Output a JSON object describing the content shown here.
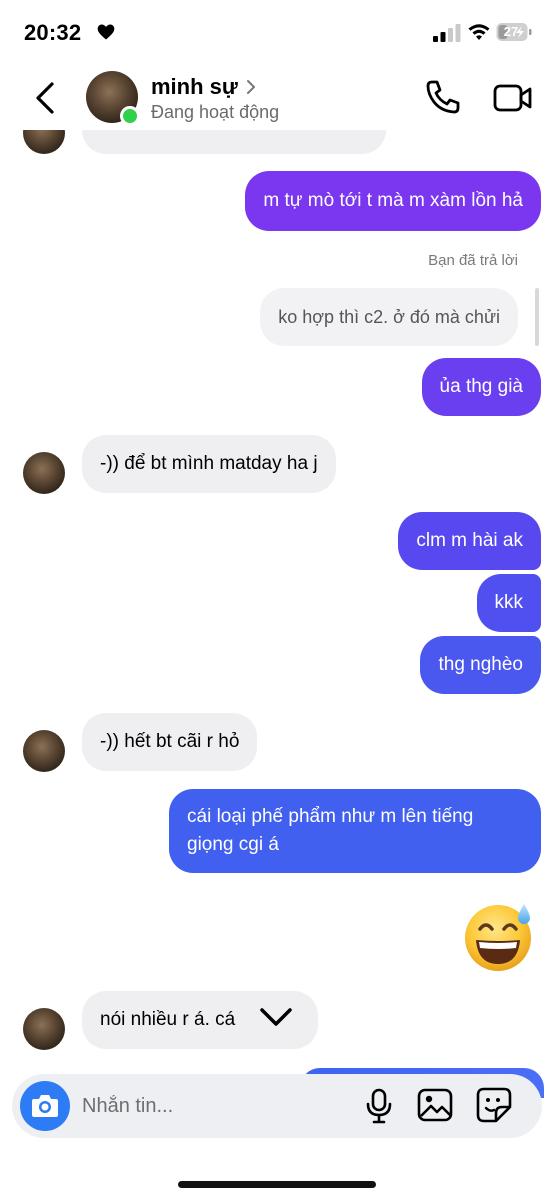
{
  "status_bar": {
    "time": "20:32",
    "battery": "27"
  },
  "header": {
    "contact_name": "minh sự",
    "status": "Đang hoạt động"
  },
  "messages": [
    {
      "sender": "them",
      "text": "",
      "partial": true
    },
    {
      "sender": "me",
      "text": "m tự mò tới t mà m xàm lồn hả"
    },
    {
      "sender": "me",
      "reply_label": "Bạn đã trả lời",
      "quoted_text": "ko hợp thì c2. ở đó mà chửi",
      "text": "ủa thg già"
    },
    {
      "sender": "them",
      "text": "-)) để bt mình matday ha j"
    },
    {
      "sender": "me",
      "text": "clm m hài ak"
    },
    {
      "sender": "me",
      "text": "kkk"
    },
    {
      "sender": "me",
      "text": "thg nghèo"
    },
    {
      "sender": "them",
      "text": "-))  hết bt cãi r hỏ"
    },
    {
      "sender": "me",
      "text_lines": [
        "cái loại phế phẩm như m lên tiếng",
        "giọng cgi á"
      ]
    },
    {
      "sender": "me",
      "emoji": "grinning-sweat-emoji"
    },
    {
      "sender": "them",
      "text": "nói nhiều r á. cá"
    }
  ],
  "composer": {
    "placeholder": "Nhắn tin..."
  },
  "colors": {
    "out_purple": "#7b36f0",
    "out_blue": "#3d63f0",
    "in_bubble": "#efeff1",
    "online": "#2fd14b",
    "camera": "#2d7cf6"
  }
}
